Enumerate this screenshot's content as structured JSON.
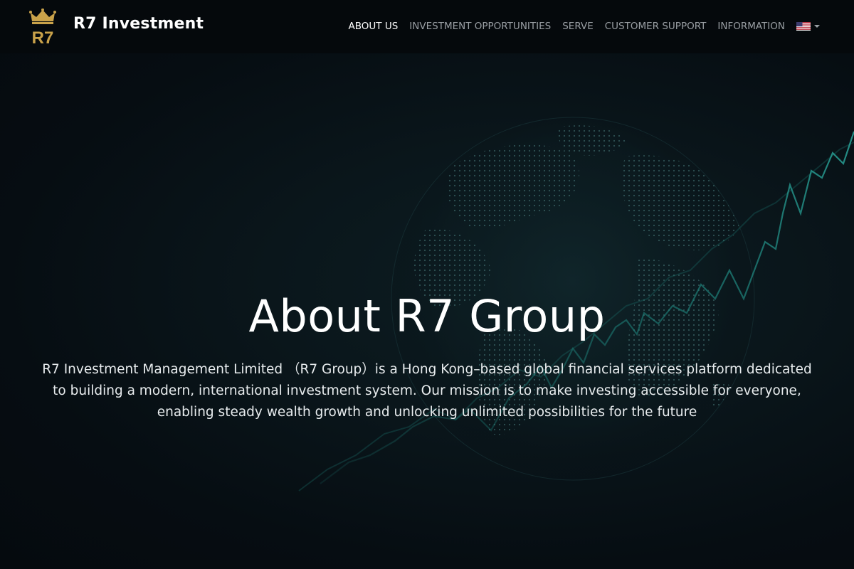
{
  "brand": {
    "logo_text": "R7",
    "name": "R7 Investment"
  },
  "nav": {
    "items": [
      {
        "label": "ABOUT US",
        "active": true
      },
      {
        "label": "INVESTMENT OPPORTUNITIES",
        "active": false
      },
      {
        "label": "SERVE",
        "active": false
      },
      {
        "label": "CUSTOMER SUPPORT",
        "active": false
      },
      {
        "label": "INFORMATION",
        "active": false
      }
    ],
    "language_flag": "us-flag-icon"
  },
  "hero": {
    "title": "About R7 Group",
    "description": "R7 Investment Management Limited （R7 Group）is a Hong Kong–based global financial services platform dedicated to building a modern, international investment system. Our mission is to make investing accessible for everyone, enabling steady wealth growth and unlocking unlimited possibilities for the future"
  },
  "colors": {
    "brand_gold": "#c9a24a",
    "accent_teal": "#1f8a82",
    "navbar_bg": "#05090c",
    "page_bg": "#060d12"
  }
}
